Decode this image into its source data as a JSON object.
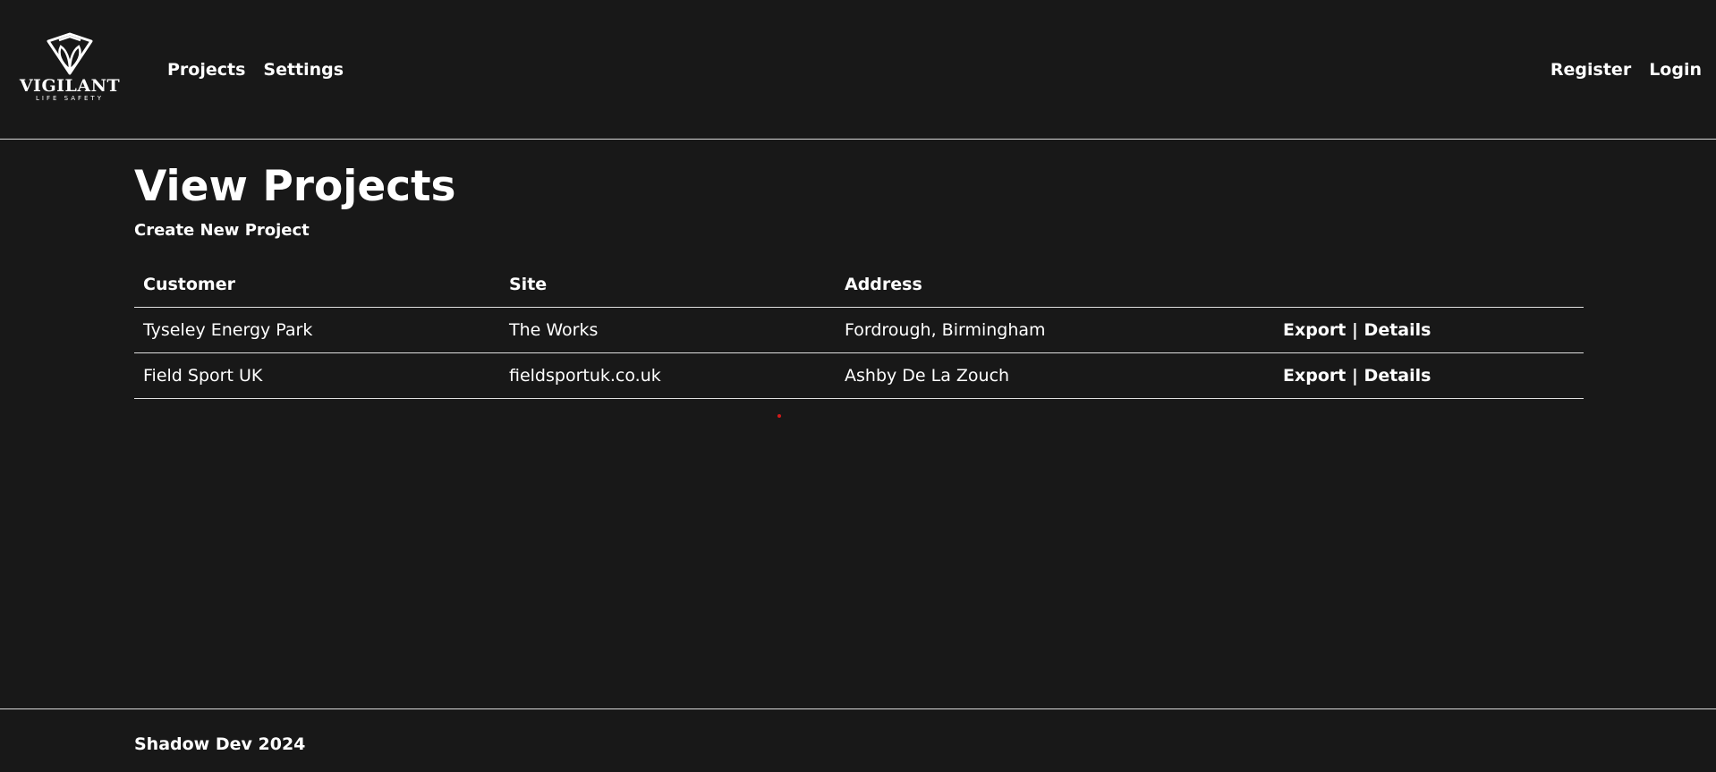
{
  "brand": {
    "name": "VIGILANT",
    "tagline": "LIFE SAFETY",
    "logo_icon": "shield-leaf-icon"
  },
  "nav": {
    "left": [
      "Projects",
      "Settings"
    ],
    "right": [
      "Register",
      "Login"
    ]
  },
  "page": {
    "title": "View Projects",
    "create_link": "Create New Project"
  },
  "table": {
    "headers": [
      "Customer",
      "Site",
      "Address",
      ""
    ],
    "rows": [
      {
        "customer": "Tyseley Energy Park",
        "site": "The Works",
        "address": "Fordrough, Birmingham",
        "export": "Export",
        "separator": "|",
        "details": "Details"
      },
      {
        "customer": "Field Sport UK",
        "site": "fieldsportuk.co.uk",
        "address": "Ashby De La Zouch",
        "export": "Export",
        "separator": "|",
        "details": "Details"
      }
    ]
  },
  "footer": {
    "text": "Shadow Dev 2024"
  },
  "colors": {
    "background": "#181818",
    "text": "#ffffff",
    "divider": "#d9d9d9",
    "cursor_dot": "#d11a1a"
  }
}
